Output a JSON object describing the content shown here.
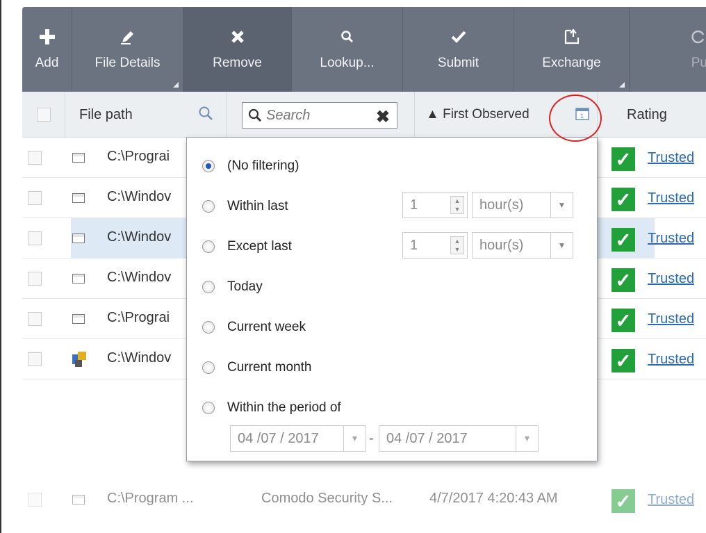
{
  "toolbar": {
    "add": "Add",
    "file_details": "File Details",
    "remove": "Remove",
    "lookup": "Lookup...",
    "submit": "Submit",
    "exchange": "Exchange",
    "partial": "Pu"
  },
  "header": {
    "file_path": "File path",
    "search_placeholder": "Search",
    "first_observed": "▲ First Observed",
    "rating": "Rating"
  },
  "rows": [
    {
      "path": "C:\\Prograi",
      "rating": "Trusted"
    },
    {
      "path": "C:\\Windov",
      "rating": "Trusted"
    },
    {
      "path": "C:\\Windov",
      "rating": "Trusted"
    },
    {
      "path": "C:\\Windov",
      "rating": "Trusted"
    },
    {
      "path": "C:\\Prograi",
      "rating": "Trusted"
    },
    {
      "path": "C:\\Windov",
      "rating": "Trusted"
    },
    {
      "path": "C:\\Program ...",
      "company": "Comodo Security S...",
      "date": "4/7/2017 4:20:43 AM",
      "rating": "Trusted"
    }
  ],
  "filter_popup": {
    "no_filtering": "(No filtering)",
    "within_last": "Within last",
    "except_last": "Except last",
    "today": "Today",
    "current_week": "Current week",
    "current_month": "Current month",
    "within_period": "Within the period of",
    "within_last_value": "1",
    "within_last_unit": "hour(s)",
    "except_last_value": "1",
    "except_last_unit": "hour(s)",
    "period_from": "04 /07 / 2017",
    "period_to": "04 /07 / 2017",
    "period_separator": "-",
    "selected": "no_filtering"
  },
  "colors": {
    "toolbar_bg": "#6b7380",
    "trusted_green": "#22a13a",
    "link_blue": "#2a6bb5",
    "highlight_red": "#e02020"
  }
}
